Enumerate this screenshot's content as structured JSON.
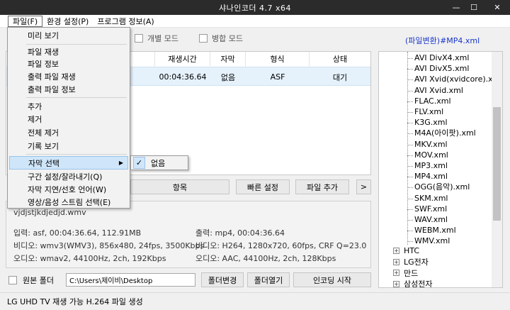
{
  "window": {
    "title": "샤나인코더 4.7 x64",
    "min_label": "—",
    "max_label": "☐",
    "close_label": "✕"
  },
  "menubar": {
    "items": [
      "파일(F)",
      "환경 설정(P)",
      "프로그램 정보(A)"
    ]
  },
  "modes": {
    "individual": "개별 모드",
    "merge": "병합 모드"
  },
  "xml_title": "(파일변환)#MP4.xml",
  "list": {
    "headers": [
      "재생시간",
      "자막",
      "형식",
      "상태"
    ],
    "row": {
      "duration": "00:04:36.64",
      "subtitle": "없음",
      "format": "ASF",
      "status": "대기"
    }
  },
  "buttons": {
    "item": "항목",
    "quick": "빠른 설정",
    "add": "파일 추가",
    "more": ">"
  },
  "info": {
    "filename": "vjdjstjkdjedjd.wmv",
    "input": "입력: asf, 00:04:36.64, 112.91MB",
    "output": "출력: mp4, 00:04:36.64",
    "video_in": "비디오: wmv3(WMV3), 856x480, 24fps, 3500Kbps",
    "video_out": "비디오: H264, 1280x720, 60fps, CRF Q=23.0",
    "audio_in": "오디오: wmav2, 44100Hz, 2ch, 192Kbps",
    "audio_out": "오디오: AAC, 44100Hz, 2ch, 128Kbps"
  },
  "folder": {
    "source_label": "원본 폴더",
    "path": "C:\\Users\\제이비\\Desktop",
    "change": "폴더변경",
    "open": "폴더열기",
    "encode": "인코딩 시작"
  },
  "status": "LG UHD TV 재생 가능 H.264 파일 생성",
  "tree": {
    "items": [
      "AVI DivX4.xml",
      "AVI DivX5.xml",
      "AVI Xvid(xvidcore).xml",
      "AVI Xvid.xml",
      "FLAC.xml",
      "FLV.xml",
      "K3G.xml",
      "M4A(아이팟).xml",
      "MKV.xml",
      "MOV.xml",
      "MP3.xml",
      "MP4.xml",
      "OGG(음악).xml",
      "SKM.xml",
      "SWF.xml",
      "WAV.xml",
      "WEBM.xml",
      "WMV.xml"
    ],
    "groups": [
      "HTC",
      "LG전자",
      "만드",
      "삼성전자"
    ]
  },
  "context_menu": {
    "items": [
      "미리 보기",
      "파일 재생",
      "파일 정보",
      "출력 파일 재생",
      "출력 파일 정보",
      "추가",
      "제거",
      "전체 제거",
      "기록 보기",
      "자막 선택",
      "구간 설정/잘라내기(Q)",
      "자막 지연/선호 언어(W)",
      "영상/음성 스트림 선택(E)"
    ],
    "submenu_item": "없음",
    "submenu_check": "✓",
    "submenu_arrow": "▶"
  }
}
